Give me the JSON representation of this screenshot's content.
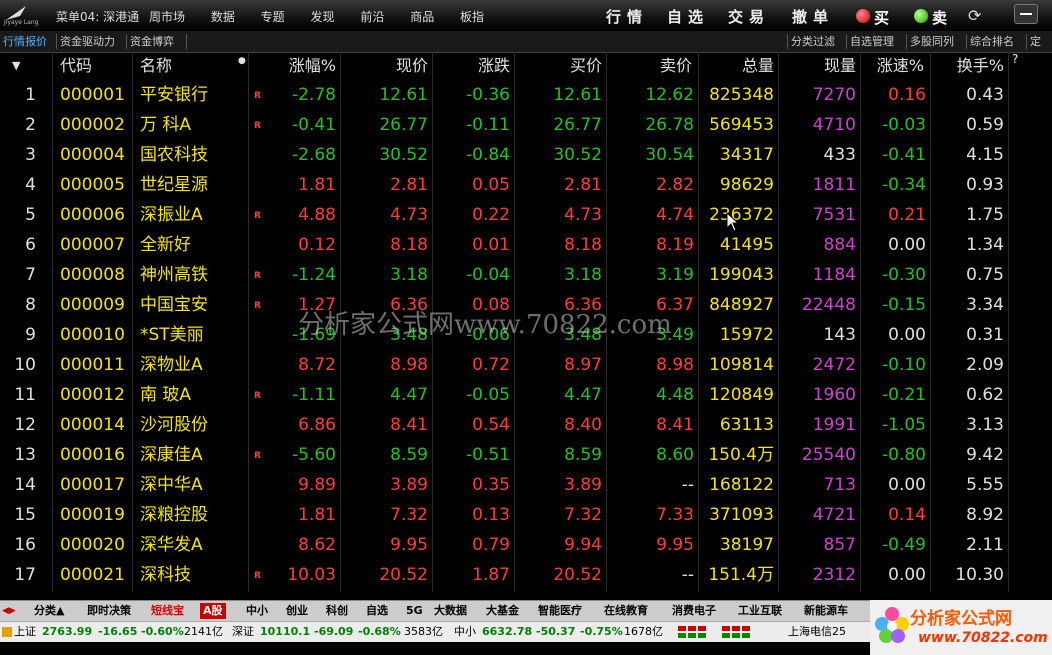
{
  "window": {
    "logo_text": "Jiyaye Lang",
    "menu": [
      "菜单04: 深港通",
      "周市场",
      "数据",
      "专题",
      "发现",
      "前沿",
      "商品",
      "板指"
    ],
    "trade_links": [
      "行情",
      "自选",
      "交易",
      "撤单"
    ],
    "buy_label": "买",
    "sell_label": "卖"
  },
  "left_tabs": [
    "行情报价",
    "资金驱动力",
    "资金博弈"
  ],
  "right_tabs": [
    "分类过滤",
    "自选管理",
    "多股同列",
    "综合排名",
    "定"
  ],
  "columns": [
    "代码",
    "名称",
    "涨幅%",
    "现价",
    "涨跌",
    "买价",
    "卖价",
    "总量",
    "现量",
    "涨速%",
    "换手%"
  ],
  "help_mark": "?",
  "rows": [
    {
      "i": "1",
      "code": "000001",
      "name": "平安银行",
      "r": "R",
      "pct": "-2.78",
      "price": "12.61",
      "chg": "-0.36",
      "bid": "12.61",
      "ask": "12.62",
      "vol": "825348",
      "cur": "7270",
      "spd": "0.16",
      "turn": "0.43",
      "pc": "dn",
      "cc": "dn",
      "bc": "dn",
      "ac": "dn",
      "sc": "up"
    },
    {
      "i": "2",
      "code": "000002",
      "name": "万 科A",
      "r": "R",
      "pct": "-0.41",
      "price": "26.77",
      "chg": "-0.11",
      "bid": "26.77",
      "ask": "26.78",
      "vol": "569453",
      "cur": "4710",
      "spd": "-0.03",
      "turn": "0.59",
      "pc": "dn",
      "cc": "dn",
      "bc": "dn",
      "ac": "dn",
      "sc": "dn"
    },
    {
      "i": "3",
      "code": "000004",
      "name": "国农科技",
      "r": "",
      "pct": "-2.68",
      "price": "30.52",
      "chg": "-0.84",
      "bid": "30.52",
      "ask": "30.54",
      "vol": "34317",
      "cur": "433",
      "spd": "-0.41",
      "turn": "4.15",
      "pc": "dn",
      "cc": "dn",
      "bc": "dn",
      "ac": "dn",
      "sc": "dn",
      "curc": "flat"
    },
    {
      "i": "4",
      "code": "000005",
      "name": "世纪星源",
      "r": "",
      "pct": "1.81",
      "price": "2.81",
      "chg": "0.05",
      "bid": "2.81",
      "ask": "2.82",
      "vol": "98629",
      "cur": "1811",
      "spd": "-0.34",
      "turn": "0.93",
      "pc": "up",
      "cc": "up",
      "bc": "up",
      "ac": "up",
      "sc": "dn"
    },
    {
      "i": "5",
      "code": "000006",
      "name": "深振业A",
      "r": "R",
      "pct": "4.88",
      "price": "4.73",
      "chg": "0.22",
      "bid": "4.73",
      "ask": "4.74",
      "vol": "236372",
      "cur": "7531",
      "spd": "0.21",
      "turn": "1.75",
      "pc": "up",
      "cc": "up",
      "bc": "up",
      "ac": "up",
      "sc": "up"
    },
    {
      "i": "6",
      "code": "000007",
      "name": "全新好",
      "r": "",
      "pct": "0.12",
      "price": "8.18",
      "chg": "0.01",
      "bid": "8.18",
      "ask": "8.19",
      "vol": "41495",
      "cur": "884",
      "spd": "0.00",
      "turn": "1.34",
      "pc": "up",
      "cc": "up",
      "bc": "up",
      "ac": "up",
      "sc": "flat"
    },
    {
      "i": "7",
      "code": "000008",
      "name": "神州高铁",
      "r": "R",
      "pct": "-1.24",
      "price": "3.18",
      "chg": "-0.04",
      "bid": "3.18",
      "ask": "3.19",
      "vol": "199043",
      "cur": "1184",
      "spd": "-0.30",
      "turn": "0.75",
      "pc": "dn",
      "cc": "dn",
      "bc": "dn",
      "ac": "dn",
      "sc": "dn"
    },
    {
      "i": "8",
      "code": "000009",
      "name": "中国宝安",
      "r": "R",
      "pct": "1.27",
      "price": "6.36",
      "chg": "0.08",
      "bid": "6.36",
      "ask": "6.37",
      "vol": "848927",
      "cur": "22448",
      "spd": "-0.15",
      "turn": "3.34",
      "pc": "up",
      "cc": "up",
      "bc": "up",
      "ac": "up",
      "sc": "dn"
    },
    {
      "i": "9",
      "code": "000010",
      "name": "*ST美丽",
      "r": "",
      "pct": "-1.69",
      "price": "3.48",
      "chg": "-0.06",
      "bid": "3.48",
      "ask": "3.49",
      "vol": "15972",
      "cur": "143",
      "spd": "0.00",
      "turn": "0.31",
      "pc": "dn",
      "cc": "dn",
      "bc": "dn",
      "ac": "dn",
      "sc": "flat",
      "curc": "flat"
    },
    {
      "i": "10",
      "code": "000011",
      "name": "深物业A",
      "r": "",
      "pct": "8.72",
      "price": "8.98",
      "chg": "0.72",
      "bid": "8.97",
      "ask": "8.98",
      "vol": "109814",
      "cur": "2472",
      "spd": "-0.10",
      "turn": "2.09",
      "pc": "up",
      "cc": "up",
      "bc": "up",
      "ac": "up",
      "sc": "dn"
    },
    {
      "i": "11",
      "code": "000012",
      "name": "南 玻A",
      "r": "R",
      "pct": "-1.11",
      "price": "4.47",
      "chg": "-0.05",
      "bid": "4.47",
      "ask": "4.48",
      "vol": "120849",
      "cur": "1960",
      "spd": "-0.21",
      "turn": "0.62",
      "pc": "dn",
      "cc": "dn",
      "bc": "dn",
      "ac": "dn",
      "sc": "dn"
    },
    {
      "i": "12",
      "code": "000014",
      "name": "沙河股份",
      "r": "",
      "pct": "6.86",
      "price": "8.41",
      "chg": "0.54",
      "bid": "8.40",
      "ask": "8.41",
      "vol": "63113",
      "cur": "1991",
      "spd": "-1.05",
      "turn": "3.13",
      "pc": "up",
      "cc": "up",
      "bc": "up",
      "ac": "up",
      "sc": "dn"
    },
    {
      "i": "13",
      "code": "000016",
      "name": "深康佳A",
      "r": "R",
      "pct": "-5.60",
      "price": "8.59",
      "chg": "-0.51",
      "bid": "8.59",
      "ask": "8.60",
      "vol": "150.4万",
      "cur": "25540",
      "spd": "-0.80",
      "turn": "9.42",
      "pc": "dn",
      "cc": "dn",
      "bc": "dn",
      "ac": "dn",
      "sc": "dn"
    },
    {
      "i": "14",
      "code": "000017",
      "name": "深中华A",
      "r": "",
      "pct": "9.89",
      "price": "3.89",
      "chg": "0.35",
      "bid": "3.89",
      "ask": "--",
      "vol": "168122",
      "cur": "713",
      "spd": "0.00",
      "turn": "5.55",
      "pc": "up",
      "cc": "up",
      "bc": "up",
      "ac": "flat",
      "sc": "flat"
    },
    {
      "i": "15",
      "code": "000019",
      "name": "深粮控股",
      "r": "",
      "pct": "1.81",
      "price": "7.32",
      "chg": "0.13",
      "bid": "7.32",
      "ask": "7.33",
      "vol": "371093",
      "cur": "4721",
      "spd": "0.14",
      "turn": "8.92",
      "pc": "up",
      "cc": "up",
      "bc": "up",
      "ac": "up",
      "sc": "up"
    },
    {
      "i": "16",
      "code": "000020",
      "name": "深华发A",
      "r": "",
      "pct": "8.62",
      "price": "9.95",
      "chg": "0.79",
      "bid": "9.94",
      "ask": "9.95",
      "vol": "38197",
      "cur": "857",
      "spd": "-0.49",
      "turn": "2.11",
      "pc": "up",
      "cc": "up",
      "bc": "up",
      "ac": "up",
      "sc": "dn"
    },
    {
      "i": "17",
      "code": "000021",
      "name": "深科技",
      "r": "R",
      "pct": "10.03",
      "price": "20.52",
      "chg": "1.87",
      "bid": "20.52",
      "ask": "--",
      "vol": "151.4万",
      "cur": "2312",
      "spd": "0.00",
      "turn": "10.30",
      "pc": "up",
      "cc": "up",
      "bc": "up",
      "ac": "flat",
      "sc": "flat"
    }
  ],
  "watermark": "分析家公式网www.70822.com",
  "sectors": [
    "分类▲",
    "即时决策",
    "短线宝",
    "A股",
    "中小",
    "创业",
    "科创",
    "自选",
    "5G",
    "大数据",
    "大基金",
    "智能医疗",
    "在线教育",
    "消费电子",
    "工业互联",
    "新能源车"
  ],
  "status": {
    "sh_label": "上证",
    "sh_val": "2763.99",
    "sh_chg": "-16.65",
    "sh_pct": "-0.60%",
    "sh_amt": "2141亿",
    "sz_label": "深证",
    "sz_val": "10110.1",
    "sz_chg": "-69.09",
    "sz_pct": "-0.68%",
    "sz_amt": "3583亿",
    "zx_label": "中小",
    "zx_val": "6632.78",
    "zx_chg": "-50.37",
    "zx_pct": "-0.75%",
    "zx_amt": "1678亿",
    "ticker": "上海电信25"
  },
  "brand": {
    "line1": "分析家公式网",
    "line2": "www.70822.com"
  },
  "colors": {
    "up": "#ff3a3a",
    "down": "#22c022",
    "code": "#f4e400",
    "volume": "#d040d0"
  }
}
